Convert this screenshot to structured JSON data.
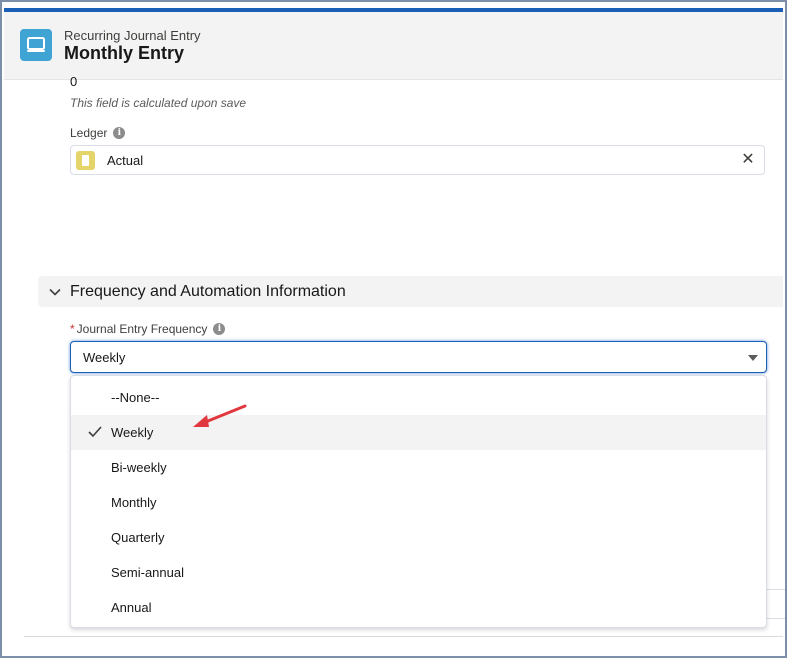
{
  "header": {
    "object_type": "Recurring Journal Entry",
    "record_name": "Monthly Entry",
    "icon": "computer-icon"
  },
  "fields": {
    "calculated_value": "0",
    "calculated_help": "This field is calculated upon save",
    "ledger_label": "Ledger",
    "ledger_value": "Actual"
  },
  "section": {
    "title": "Frequency and Automation Information"
  },
  "frequency": {
    "label": "Journal Entry Frequency",
    "required_marker": "*",
    "selected": "Weekly",
    "options": [
      "--None--",
      "Weekly",
      "Bi-weekly",
      "Monthly",
      "Quarterly",
      "Semi-annual",
      "Annual"
    ]
  },
  "colors": {
    "accent": "#1b5fb6",
    "record_icon": "#3fa4d4",
    "ledger_icon": "#e4d46a",
    "annotation": "#e0383e"
  }
}
